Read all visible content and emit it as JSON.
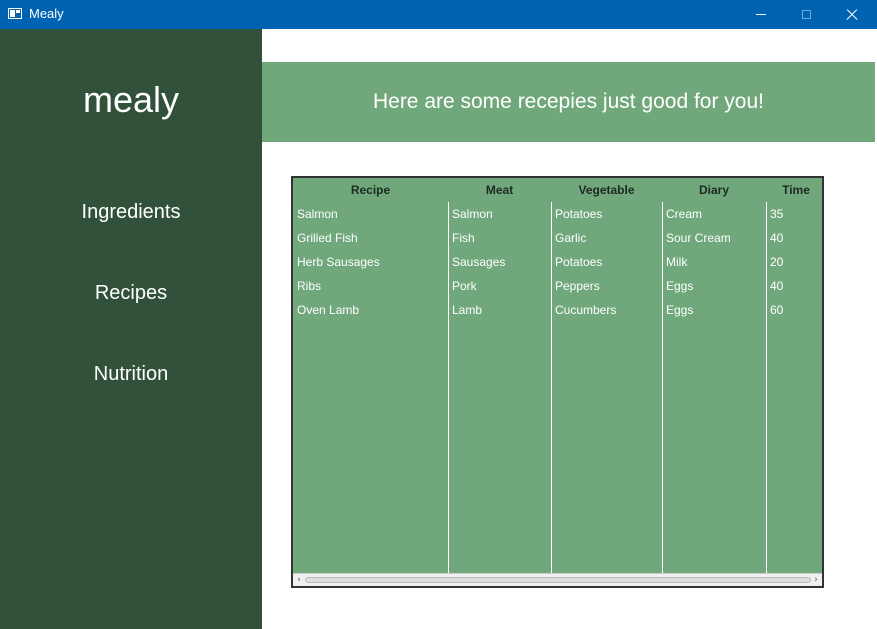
{
  "window": {
    "title": "Mealy",
    "app_icon": "app-window-icon",
    "titlebar_color": "#0063b1"
  },
  "sidebar": {
    "logo": "mealy",
    "background": "#32513b",
    "items": [
      {
        "label": "Ingredients"
      },
      {
        "label": "Recipes"
      },
      {
        "label": "Nutrition"
      }
    ]
  },
  "main": {
    "banner_text": "Here are some recepies just good for you!",
    "accent": "#70a87b"
  },
  "table": {
    "columns": [
      "Recipe",
      "Meat",
      "Vegetable",
      "Diary",
      "Time"
    ],
    "rows": [
      [
        "Salmon",
        "Salmon",
        "Potatoes",
        "Cream",
        "35"
      ],
      [
        "Grilled Fish",
        "Fish",
        "Garlic",
        "Sour Cream",
        "40"
      ],
      [
        "Herb Sausages",
        "Sausages",
        "Potatoes",
        "Milk",
        "20"
      ],
      [
        "Ribs",
        "Pork",
        "Peppers",
        "Eggs",
        "40"
      ],
      [
        "Oven Lamb",
        "Lamb",
        "Cucumbers",
        "Eggs",
        "60"
      ]
    ]
  }
}
